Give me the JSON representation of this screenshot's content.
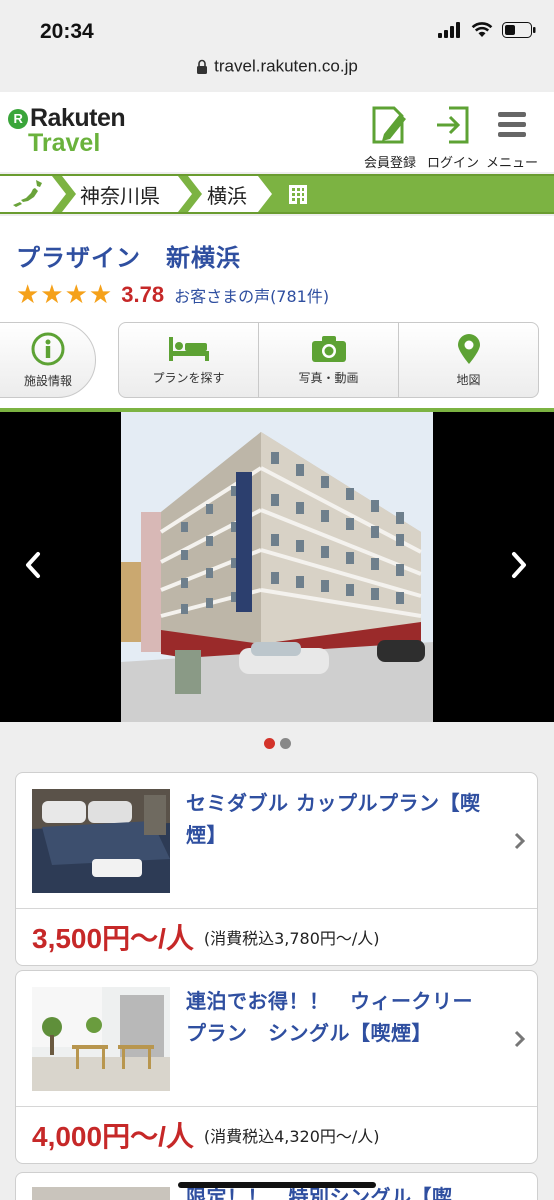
{
  "status_bar": {
    "time": "20:34"
  },
  "browser": {
    "url": "travel.rakuten.co.jp"
  },
  "header": {
    "logo_top": "Rakuten",
    "logo_bottom": "Travel",
    "register_label": "会員登録",
    "login_label": "ログイン",
    "menu_label": "メニュー"
  },
  "breadcrumb": {
    "items": [
      "神奈川県",
      "横浜"
    ]
  },
  "hotel": {
    "name": "プラザイン　新横浜",
    "stars": "★★★★",
    "score": "3.78",
    "reviews": "お客さまの声(781件)"
  },
  "tabs": {
    "info": "施設情報",
    "plan": "プランを探す",
    "photo": "写真・動画",
    "map": "地図"
  },
  "carousel": {
    "current": 1,
    "total": 2
  },
  "plans": [
    {
      "title": "セミダブル カップルプラン【喫煙】",
      "price": "3,500円〜/人",
      "price_tax": "(消費税込3,780円〜/人)"
    },
    {
      "title": "連泊でお得！！　ウィークリープラン　シングル【喫煙】",
      "price": "4,000円〜/人",
      "price_tax": "(消費税込4,320円〜/人)"
    },
    {
      "title": "限定！！　特別シングル【喫"
    }
  ],
  "colors": {
    "accent_green": "#7cb342",
    "title_blue": "#2f4fa0",
    "price_red": "#c62828",
    "star_orange": "#f5a11a"
  }
}
